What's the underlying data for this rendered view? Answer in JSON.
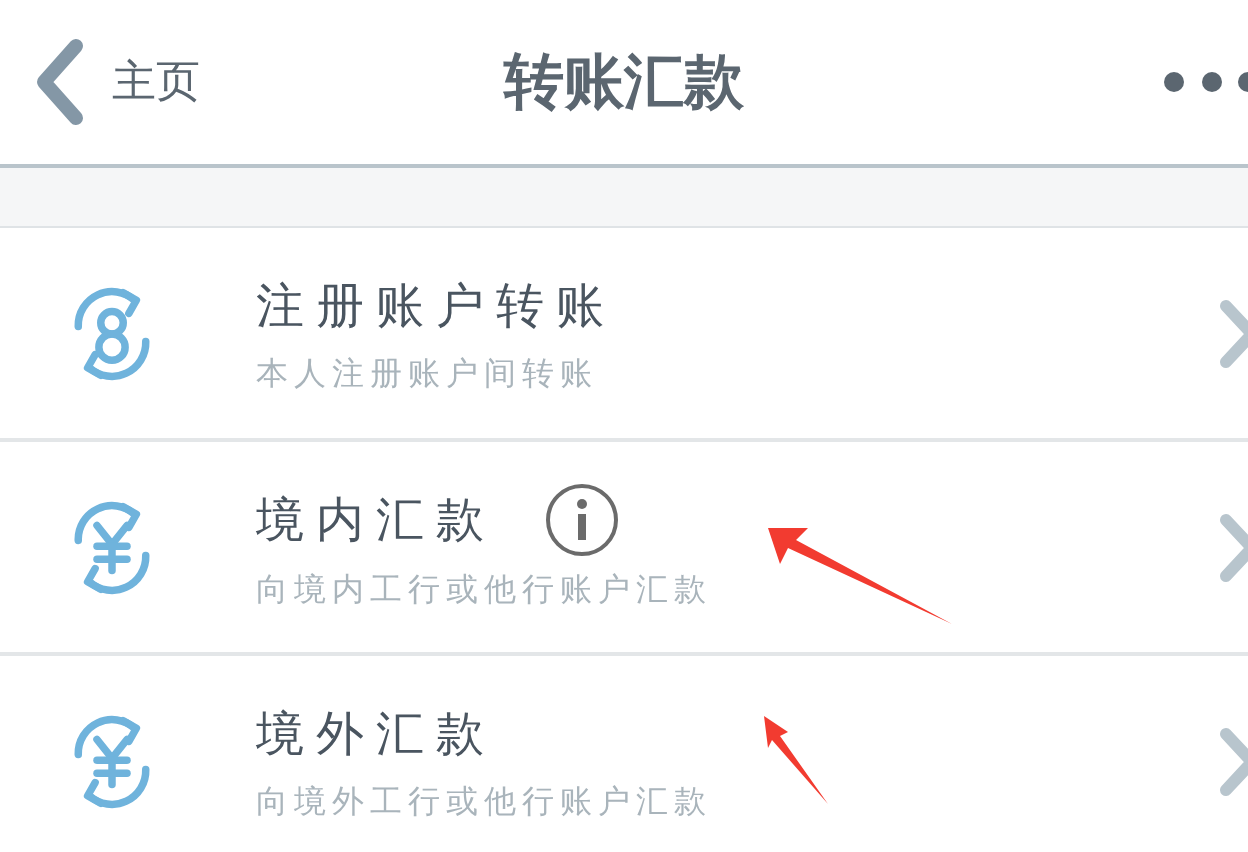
{
  "header": {
    "back_label": "主页",
    "title": "转账汇款"
  },
  "items": [
    {
      "kind": "account",
      "title": "注册账户转账",
      "subtitle": "本人注册账户间转账",
      "info": false
    },
    {
      "kind": "yuan",
      "title": "境内汇款",
      "subtitle": "向境内工行或他行账户汇款",
      "info": true
    },
    {
      "kind": "yuan",
      "title": "境外汇款",
      "subtitle": "向境外工行或他行账户汇款",
      "info": false
    }
  ]
}
